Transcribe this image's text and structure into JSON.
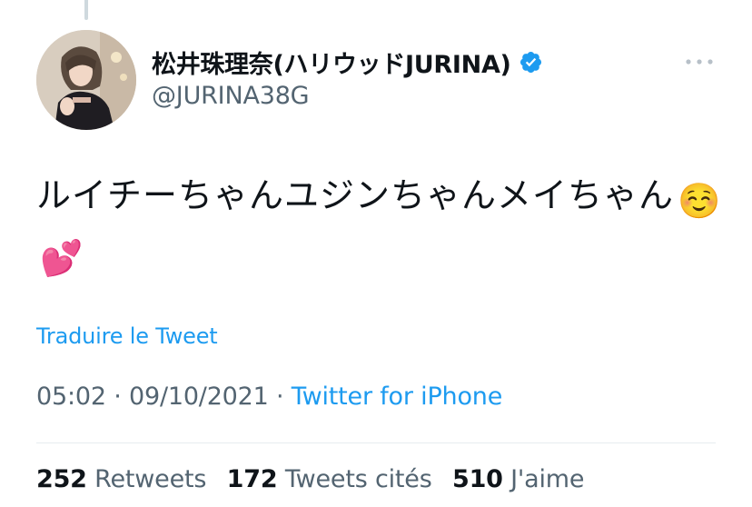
{
  "tweet": {
    "author": {
      "display_name": "松井珠理奈(ハリウッドJURINA)",
      "handle": "@JURINA38G",
      "verified": true,
      "avatar_icon": "profile-photo"
    },
    "text": "ルイチーちゃんユジンちゃんメイちゃん",
    "emojis": [
      "☺️",
      "💕"
    ],
    "translate_label": "Traduire le Tweet",
    "time": "05:02",
    "date": "09/10/2021",
    "separator": "·",
    "source": "Twitter for iPhone"
  },
  "stats": {
    "retweets": {
      "count": "252",
      "label": "Retweets"
    },
    "quotes": {
      "count": "172",
      "label": "Tweets cités"
    },
    "likes": {
      "count": "510",
      "label": "J'aime"
    }
  },
  "colors": {
    "link": "#1d9bf0",
    "secondary_text": "#536471",
    "primary_text": "#0f1419",
    "verified": "#1d9bf0"
  }
}
